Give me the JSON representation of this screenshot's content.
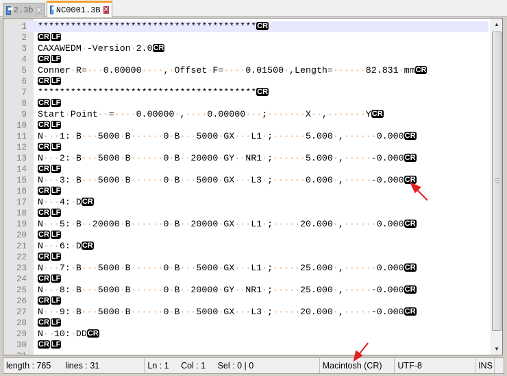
{
  "tabs": [
    {
      "label": "2.3b",
      "active": false
    },
    {
      "label": "NC0001.3B",
      "active": true
    }
  ],
  "editor": {
    "lines": [
      {
        "text": "****************************************",
        "eol": [
          "CR"
        ]
      },
      {
        "text": "",
        "eol": [
          "CR",
          "LF"
        ]
      },
      {
        "text": "CAXAWEDM -Version 2.0",
        "eol": [
          "CR"
        ]
      },
      {
        "text": "",
        "eol": [
          "CR",
          "LF"
        ]
      },
      {
        "text": "Conner R=   0.00000    , Offset F=    0.01500 ,Length=      82.831 mm",
        "eol": [
          "CR"
        ]
      },
      {
        "text": "",
        "eol": [
          "CR",
          "LF"
        ]
      },
      {
        "text": "****************************************",
        "eol": [
          "CR"
        ]
      },
      {
        "text": "",
        "eol": [
          "CR",
          "LF"
        ]
      },
      {
        "text": "Start Point  =    0.00000 ,    0.00000   ;       X  ,       Y",
        "eol": [
          "CR"
        ]
      },
      {
        "text": "",
        "eol": [
          "CR",
          "LF"
        ]
      },
      {
        "text": "N   1: B   5000 B      0 B   5000 GX   L1 ;      5.000 ,      0.000",
        "eol": [
          "CR"
        ]
      },
      {
        "text": "",
        "eol": [
          "CR",
          "LF"
        ]
      },
      {
        "text": "N   2: B   5000 B      0 B  20000 GY  NR1 ;      5.000 ,     -0.000",
        "eol": [
          "CR"
        ]
      },
      {
        "text": "",
        "eol": [
          "CR",
          "LF"
        ]
      },
      {
        "text": "N   3: B   5000 B      0 B   5000 GX   L3 ;      0.000 ,     -0.000",
        "eol": [
          "CR"
        ]
      },
      {
        "text": "",
        "eol": [
          "CR",
          "LF"
        ]
      },
      {
        "text": "N   4: D",
        "eol": [
          "CR"
        ]
      },
      {
        "text": "",
        "eol": [
          "CR",
          "LF"
        ]
      },
      {
        "text": "N   5: B  20000 B      0 B  20000 GX   L1 ;     20.000 ,      0.000",
        "eol": [
          "CR"
        ]
      },
      {
        "text": "",
        "eol": [
          "CR",
          "LF"
        ]
      },
      {
        "text": "N   6: D",
        "eol": [
          "CR"
        ]
      },
      {
        "text": "",
        "eol": [
          "CR",
          "LF"
        ]
      },
      {
        "text": "N   7: B   5000 B      0 B   5000 GX   L1 ;     25.000 ,      0.000",
        "eol": [
          "CR"
        ]
      },
      {
        "text": "",
        "eol": [
          "CR",
          "LF"
        ]
      },
      {
        "text": "N   8: B   5000 B      0 B  20000 GY  NR1 ;     25.000 ,     -0.000",
        "eol": [
          "CR"
        ]
      },
      {
        "text": "",
        "eol": [
          "CR",
          "LF"
        ]
      },
      {
        "text": "N   9: B   5000 B      0 B   5000 GX   L3 ;     20.000 ,     -0.000",
        "eol": [
          "CR"
        ]
      },
      {
        "text": "",
        "eol": [
          "CR",
          "LF"
        ]
      },
      {
        "text": "N  10: DD",
        "eol": [
          "CR"
        ]
      },
      {
        "text": "",
        "eol": [
          "CR",
          "LF"
        ]
      },
      {
        "text": "",
        "eol": []
      }
    ]
  },
  "status": {
    "length": "length : 765",
    "lines": "lines : 31",
    "ln": "Ln : 1",
    "col": "Col : 1",
    "sel": "Sel : 0 | 0",
    "eol_format": "Macintosh (CR)",
    "encoding": "UTF-8",
    "mode": "INS"
  },
  "colors": {
    "current_line": "#e8e8ff",
    "whitespace": "#f0a060",
    "annotation_arrow": "#e02020"
  }
}
